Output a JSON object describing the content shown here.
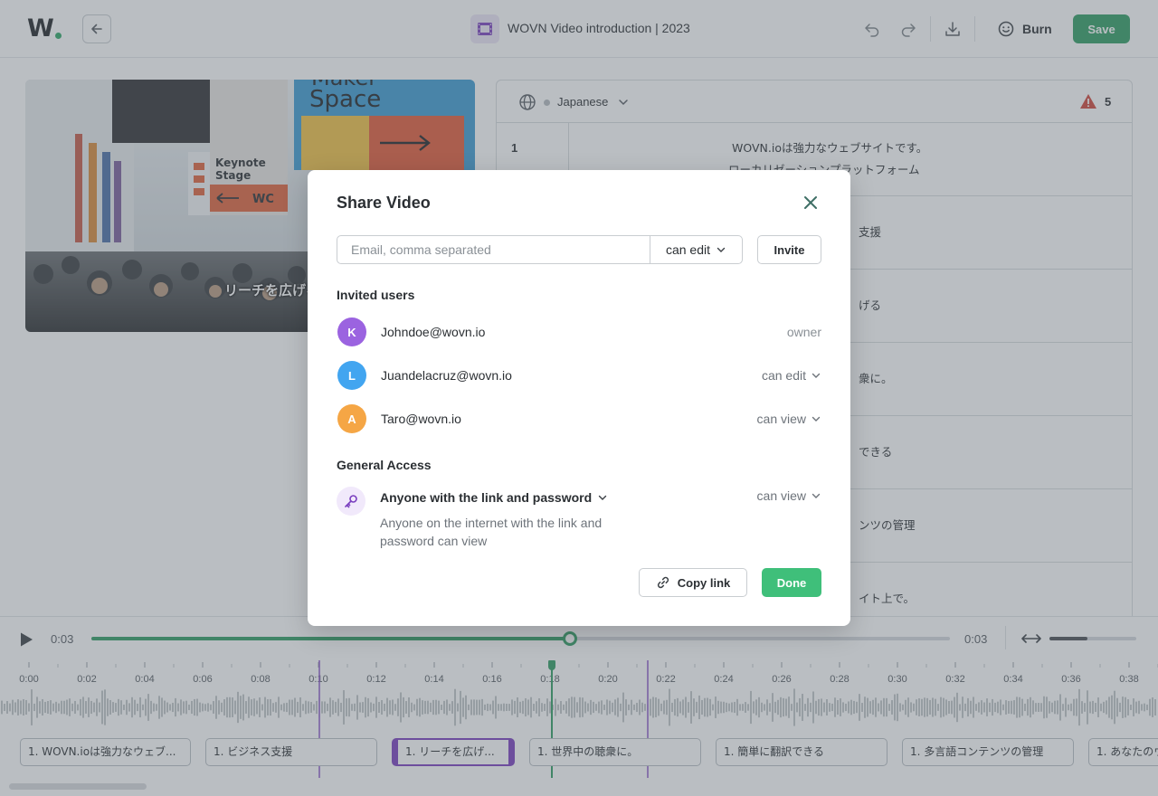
{
  "app": {
    "logo": "W",
    "document_title": "WOVN Video introduction | 2023",
    "burn_label": "Burn",
    "save_label": "Save",
    "accent_color": "#2f9e62"
  },
  "video": {
    "overlay_subtitle": "リーチを広げる",
    "sign_top": "Maker Space",
    "sign_keynote": "Keynote Stage",
    "sign_wc": "WC"
  },
  "subtitle_panel": {
    "language": "Japanese",
    "warning_count": "5",
    "rows": [
      {
        "num": "1",
        "line1": "WOVN.ioは強力なウェブサイトです。",
        "line2": "ローカリゼーションプラットフォーム"
      },
      {
        "num": "",
        "partial": "支援"
      },
      {
        "num": "",
        "partial": "げる"
      },
      {
        "num": "",
        "partial": "衆に。"
      },
      {
        "num": "",
        "partial": "できる"
      },
      {
        "num": "",
        "partial": "ンツの管理"
      },
      {
        "num": "",
        "partial": "イト上で。"
      }
    ]
  },
  "timeline": {
    "current_time": "0:03",
    "end_time": "0:03",
    "progress": 0.557,
    "zoom_level": 0.44,
    "tick_labels": [
      "0:00",
      "0:02",
      "0:04",
      "0:06",
      "0:08",
      "0:10",
      "0:12",
      "0:14",
      "0:16",
      "0:18",
      "0:20",
      "0:22",
      "0:24",
      "0:26",
      "0:28",
      "0:30",
      "0:32",
      "0:34",
      "0:36",
      "0:38"
    ],
    "captions": [
      {
        "label": "1. WOVN.ioは強力なウェブ..."
      },
      {
        "label": "1. ビジネス支援"
      },
      {
        "label": "1. リーチを広げ..."
      },
      {
        "label": "1. 世界中の聴衆に。"
      },
      {
        "label": "1. 簡単に翻訳できる"
      },
      {
        "label": "1. 多言語コンテンツの管理"
      },
      {
        "label": "1. あなたのウ"
      }
    ]
  },
  "share_modal": {
    "title": "Share Video",
    "email_placeholder": "Email, comma separated",
    "permission": "can edit",
    "invite_label": "Invite",
    "invited_title": "Invited users",
    "users": [
      {
        "initial": "K",
        "email": "Johndoe@wovn.io",
        "role": "owner",
        "color": "#9b63e0"
      },
      {
        "initial": "L",
        "email": "Juandelacruz@wovn.io",
        "role": "can edit",
        "color": "#42a5f0"
      },
      {
        "initial": "A",
        "email": "Taro@wovn.io",
        "role": "can view",
        "color": "#f5a645"
      }
    ],
    "general_access_title": "General Access",
    "access_mode": "Anyone with the link and password",
    "access_description": "Anyone on the internet with the link and password can view",
    "access_role": "can view",
    "copy_link_label": "Copy link",
    "done_label": "Done"
  }
}
